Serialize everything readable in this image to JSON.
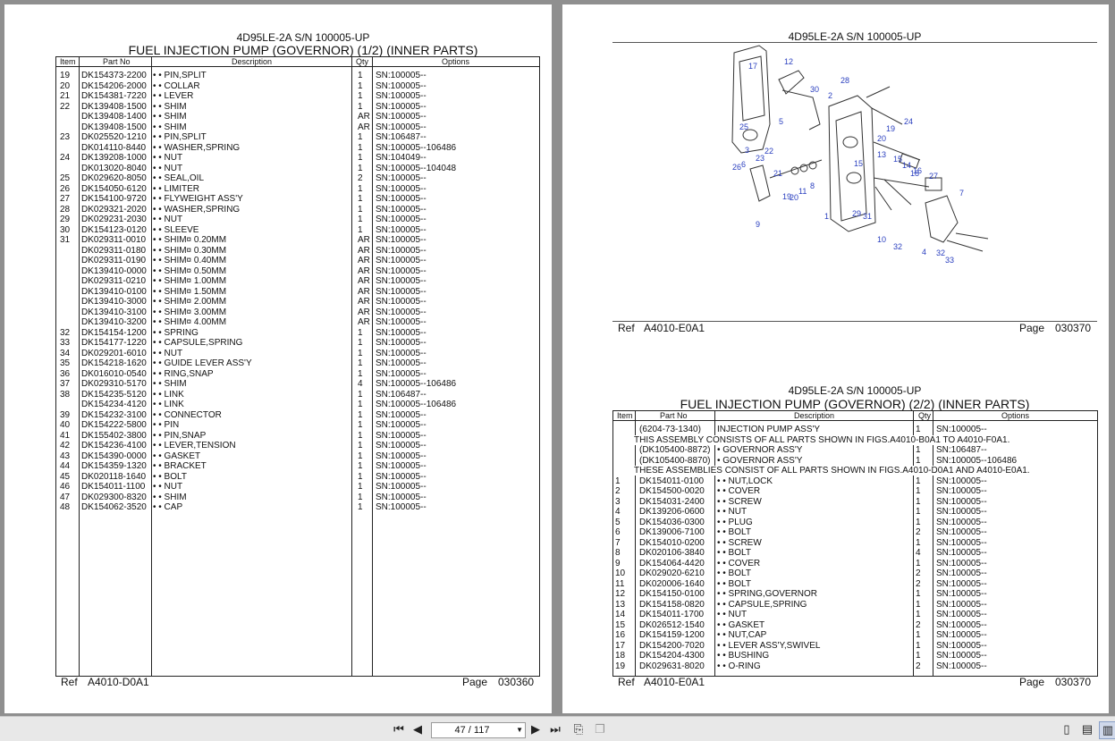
{
  "left_page": {
    "model": "4D95LE-2A S/N 100005-UP",
    "title": "FUEL INJECTION PUMP (GOVERNOR) (1/2) (INNER PARTS)",
    "headers": {
      "item": "Item",
      "part_no": "Part No",
      "description": "Description",
      "qty": "Qty",
      "options": "Options"
    },
    "rows": [
      {
        "item": "19",
        "part": "DK154373-2200",
        "desc": "• • PIN,SPLIT",
        "qty": "1",
        "opt": "SN:100005--"
      },
      {
        "item": "20",
        "part": "DK154206-2000",
        "desc": "• • COLLAR",
        "qty": "1",
        "opt": "SN:100005--"
      },
      {
        "item": "21",
        "part": "DK154381-7220",
        "desc": "• • LEVER",
        "qty": "1",
        "opt": "SN:100005--"
      },
      {
        "item": "22",
        "part": "DK139408-1500",
        "desc": "• • SHIM",
        "qty": "1",
        "opt": "SN:100005--"
      },
      {
        "item": "",
        "part": "DK139408-1400",
        "desc": "• • SHIM",
        "qty": "AR",
        "opt": "SN:100005--"
      },
      {
        "item": "",
        "part": "DK139408-1500",
        "desc": "• • SHIM",
        "qty": "AR",
        "opt": "SN:100005--"
      },
      {
        "item": "23",
        "part": "DK025520-1210",
        "desc": "• • PIN,SPLIT",
        "qty": "1",
        "opt": "SN:106487--"
      },
      {
        "item": "",
        "part": "DK014110-8440",
        "desc": "• • WASHER,SPRING",
        "qty": "1",
        "opt": "SN:100005--106486"
      },
      {
        "item": "24",
        "part": "DK139208-1000",
        "desc": "• • NUT",
        "qty": "1",
        "opt": "SN:104049--"
      },
      {
        "item": "",
        "part": "DK013020-8040",
        "desc": "• • NUT",
        "qty": "1",
        "opt": "SN:100005--104048"
      },
      {
        "item": "25",
        "part": "DK029620-8050",
        "desc": "• • SEAL,OIL",
        "qty": "2",
        "opt": "SN:100005--"
      },
      {
        "item": "26",
        "part": "DK154050-6120",
        "desc": "• • LIMITER",
        "qty": "1",
        "opt": "SN:100005--"
      },
      {
        "item": "27",
        "part": "DK154100-9720",
        "desc": "• • FLYWEIGHT ASS'Y",
        "qty": "1",
        "opt": "SN:100005--"
      },
      {
        "item": "28",
        "part": "DK029321-2020",
        "desc": "• • WASHER,SPRING",
        "qty": "1",
        "opt": "SN:100005--"
      },
      {
        "item": "29",
        "part": "DK029231-2030",
        "desc": "• • NUT",
        "qty": "1",
        "opt": "SN:100005--"
      },
      {
        "item": "30",
        "part": "DK154123-0120",
        "desc": "• • SLEEVE",
        "qty": "1",
        "opt": "SN:100005--"
      },
      {
        "item": "31",
        "part": "DK029311-0010",
        "desc": "• • SHIM¤ 0.20MM",
        "qty": "AR",
        "opt": "SN:100005--"
      },
      {
        "item": "",
        "part": "DK029311-0180",
        "desc": "• • SHIM¤ 0.30MM",
        "qty": "AR",
        "opt": "SN:100005--"
      },
      {
        "item": "",
        "part": "DK029311-0190",
        "desc": "• • SHIM¤ 0.40MM",
        "qty": "AR",
        "opt": "SN:100005--"
      },
      {
        "item": "",
        "part": "DK139410-0000",
        "desc": "• • SHIM¤ 0.50MM",
        "qty": "AR",
        "opt": "SN:100005--"
      },
      {
        "item": "",
        "part": "DK029311-0210",
        "desc": "• • SHIM¤ 1.00MM",
        "qty": "AR",
        "opt": "SN:100005--"
      },
      {
        "item": "",
        "part": "DK139410-0100",
        "desc": "• • SHIM¤ 1.50MM",
        "qty": "AR",
        "opt": "SN:100005--"
      },
      {
        "item": "",
        "part": "DK139410-3000",
        "desc": "• • SHIM¤ 2.00MM",
        "qty": "AR",
        "opt": "SN:100005--"
      },
      {
        "item": "",
        "part": "DK139410-3100",
        "desc": "• • SHIM¤ 3.00MM",
        "qty": "AR",
        "opt": "SN:100005--"
      },
      {
        "item": "",
        "part": "DK139410-3200",
        "desc": "• • SHIM¤ 4.00MM",
        "qty": "AR",
        "opt": "SN:100005--"
      },
      {
        "item": "32",
        "part": "DK154154-1200",
        "desc": "• • SPRING",
        "qty": "1",
        "opt": "SN:100005--"
      },
      {
        "item": "33",
        "part": "DK154177-1220",
        "desc": "• • CAPSULE,SPRING",
        "qty": "1",
        "opt": "SN:100005--"
      },
      {
        "item": "34",
        "part": "DK029201-6010",
        "desc": "• • NUT",
        "qty": "1",
        "opt": "SN:100005--"
      },
      {
        "item": "35",
        "part": "DK154218-1620",
        "desc": "• • GUIDE LEVER ASS'Y",
        "qty": "1",
        "opt": "SN:100005--"
      },
      {
        "item": "36",
        "part": "DK016010-0540",
        "desc": "• • RING,SNAP",
        "qty": "1",
        "opt": "SN:100005--"
      },
      {
        "item": "37",
        "part": "DK029310-5170",
        "desc": "• • SHIM",
        "qty": "4",
        "opt": "SN:100005--106486"
      },
      {
        "item": "38",
        "part": "DK154235-5120",
        "desc": "• • LINK",
        "qty": "1",
        "opt": "SN:106487--"
      },
      {
        "item": "",
        "part": "DK154234-4120",
        "desc": "• • LINK",
        "qty": "1",
        "opt": "SN:100005--106486"
      },
      {
        "item": "39",
        "part": "DK154232-3100",
        "desc": "• • CONNECTOR",
        "qty": "1",
        "opt": "SN:100005--"
      },
      {
        "item": "40",
        "part": "DK154222-5800",
        "desc": "• • PIN",
        "qty": "1",
        "opt": "SN:100005--"
      },
      {
        "item": "41",
        "part": "DK155402-3800",
        "desc": "• • PIN,SNAP",
        "qty": "1",
        "opt": "SN:100005--"
      },
      {
        "item": "42",
        "part": "DK154236-4100",
        "desc": "• • LEVER,TENSION",
        "qty": "1",
        "opt": "SN:100005--"
      },
      {
        "item": "43",
        "part": "DK154390-0000",
        "desc": "• • GASKET",
        "qty": "1",
        "opt": "SN:100005--"
      },
      {
        "item": "44",
        "part": "DK154359-1320",
        "desc": "• • BRACKET",
        "qty": "1",
        "opt": "SN:100005--"
      },
      {
        "item": "45",
        "part": "DK020118-1640",
        "desc": "• • BOLT",
        "qty": "1",
        "opt": "SN:100005--"
      },
      {
        "item": "46",
        "part": "DK154011-1100",
        "desc": "• • NUT",
        "qty": "1",
        "opt": "SN:100005--"
      },
      {
        "item": "47",
        "part": "DK029300-8320",
        "desc": "• • SHIM",
        "qty": "1",
        "opt": "SN:100005--"
      },
      {
        "item": "48",
        "part": "DK154062-3520",
        "desc": "• • CAP",
        "qty": "1",
        "opt": "SN:100005--"
      }
    ],
    "ref_label": "Ref",
    "ref": "A4010-D0A1",
    "page_label": "Page",
    "page": "030360"
  },
  "right_top": {
    "model": "4D95LE-2A S/N 100005-UP",
    "callouts": [
      "17",
      "12",
      "28",
      "30",
      "2",
      "19",
      "24",
      "25",
      "5",
      "20",
      "22",
      "3",
      "23",
      "13",
      "15",
      "14",
      "16",
      "27",
      "26",
      "6",
      "15",
      "18",
      "21",
      "19",
      "20",
      "11",
      "8",
      "7",
      "1",
      "29",
      "31",
      "9",
      "10",
      "32",
      "4",
      "32",
      "33"
    ],
    "ref_label": "Ref",
    "ref": "A4010-E0A1",
    "page_label": "Page",
    "page": "030370"
  },
  "right_bottom": {
    "model": "4D95LE-2A S/N 100005-UP",
    "title": "FUEL INJECTION PUMP (GOVERNOR) (2/2) (INNER PARTS)",
    "headers": {
      "item": "Item",
      "part_no": "Part No",
      "description": "Description",
      "qty": "Qty",
      "options": "Options"
    },
    "rows": [
      {
        "item": "",
        "part": "(6204-73-1340)",
        "desc": "INJECTION PUMP ASS'Y",
        "qty": "1",
        "opt": "SN:100005--"
      },
      {
        "note": "THIS ASSEMBLY CONSISTS OF ALL PARTS SHOWN IN FIGS.A4010-B0A1 TO A4010-F0A1."
      },
      {
        "item": "",
        "part": "(DK105400-8872)",
        "desc": "• GOVERNOR ASS'Y",
        "qty": "1",
        "opt": "SN:106487--"
      },
      {
        "item": "",
        "part": "(DK105400-8870)",
        "desc": "• GOVERNOR ASS'Y",
        "qty": "1",
        "opt": "SN:100005--106486"
      },
      {
        "note": "THESE ASSEMBLIES CONSIST OF ALL PARTS SHOWN IN FIGS.A4010-D0A1 AND A4010-E0A1."
      },
      {
        "item": "1",
        "part": "DK154011-0100",
        "desc": "• • NUT,LOCK",
        "qty": "1",
        "opt": "SN:100005--"
      },
      {
        "item": "2",
        "part": "DK154500-0020",
        "desc": "• • COVER",
        "qty": "1",
        "opt": "SN:100005--"
      },
      {
        "item": "3",
        "part": "DK154031-2400",
        "desc": "• • SCREW",
        "qty": "1",
        "opt": "SN:100005--"
      },
      {
        "item": "4",
        "part": "DK139206-0600",
        "desc": "• • NUT",
        "qty": "1",
        "opt": "SN:100005--"
      },
      {
        "item": "5",
        "part": "DK154036-0300",
        "desc": "• • PLUG",
        "qty": "1",
        "opt": "SN:100005--"
      },
      {
        "item": "6",
        "part": "DK139006-7100",
        "desc": "• • BOLT",
        "qty": "2",
        "opt": "SN:100005--"
      },
      {
        "item": "7",
        "part": "DK154010-0200",
        "desc": "• • SCREW",
        "qty": "1",
        "opt": "SN:100005--"
      },
      {
        "item": "8",
        "part": "DK020106-3840",
        "desc": "• • BOLT",
        "qty": "4",
        "opt": "SN:100005--"
      },
      {
        "item": "9",
        "part": "DK154064-4420",
        "desc": "• • COVER",
        "qty": "1",
        "opt": "SN:100005--"
      },
      {
        "item": "10",
        "part": "DK029020-6210",
        "desc": "• • BOLT",
        "qty": "2",
        "opt": "SN:100005--"
      },
      {
        "item": "11",
        "part": "DK020006-1640",
        "desc": "• • BOLT",
        "qty": "2",
        "opt": "SN:100005--"
      },
      {
        "item": "12",
        "part": "DK154150-0100",
        "desc": "• • SPRING,GOVERNOR",
        "qty": "1",
        "opt": "SN:100005--"
      },
      {
        "item": "13",
        "part": "DK154158-0820",
        "desc": "• • CAPSULE,SPRING",
        "qty": "1",
        "opt": "SN:100005--"
      },
      {
        "item": "14",
        "part": "DK154011-1700",
        "desc": "• • NUT",
        "qty": "1",
        "opt": "SN:100005--"
      },
      {
        "item": "15",
        "part": "DK026512-1540",
        "desc": "• • GASKET",
        "qty": "2",
        "opt": "SN:100005--"
      },
      {
        "item": "16",
        "part": "DK154159-1200",
        "desc": "• • NUT,CAP",
        "qty": "1",
        "opt": "SN:100005--"
      },
      {
        "item": "17",
        "part": "DK154200-7020",
        "desc": "• • LEVER ASS'Y,SWIVEL",
        "qty": "1",
        "opt": "SN:100005--"
      },
      {
        "item": "18",
        "part": "DK154204-4300",
        "desc": "• • BUSHING",
        "qty": "1",
        "opt": "SN:100005--"
      },
      {
        "item": "19",
        "part": "DK029631-8020",
        "desc": "• • O-RING",
        "qty": "2",
        "opt": "SN:100005--"
      }
    ],
    "ref_label": "Ref",
    "ref": "A4010-E0A1",
    "page_label": "Page",
    "page": "030370"
  },
  "toolbar": {
    "page_indicator": "47 / 117",
    "icons": [
      "first-page-icon",
      "prev-page-icon",
      "next-page-icon",
      "last-page-icon",
      "rotate-icon",
      "copy-icon",
      "single-page-icon",
      "continuous-icon",
      "two-page-icon"
    ]
  }
}
